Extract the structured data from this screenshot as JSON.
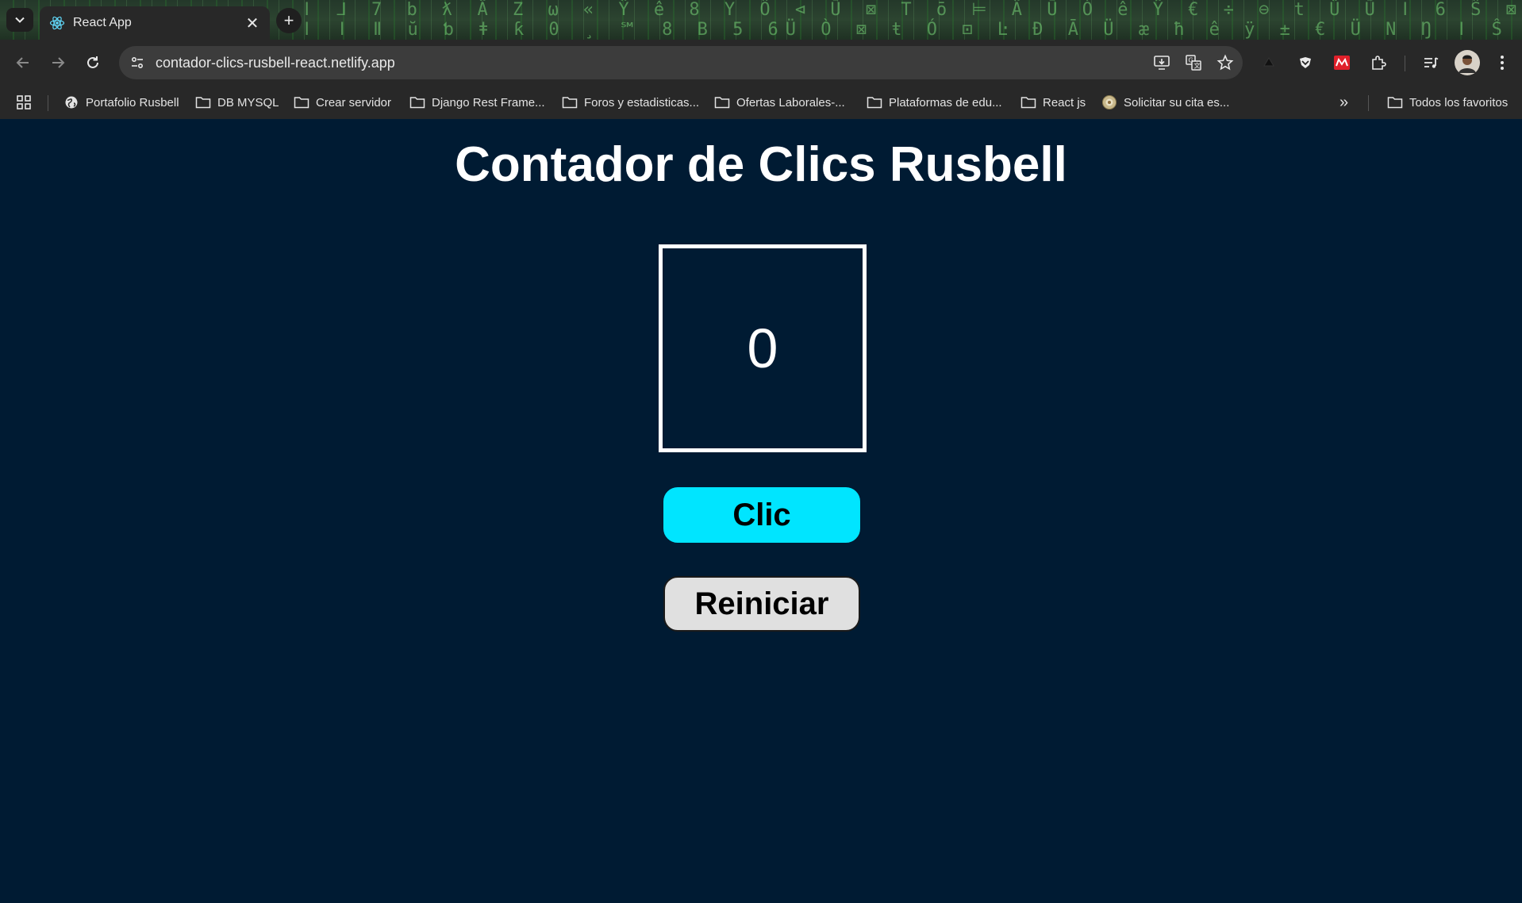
{
  "browser": {
    "tab": {
      "title": "React App"
    },
    "address_bar": {
      "url": "contador-clics-rusbell-react.netlify.app"
    },
    "bookmarks": [
      {
        "label": "Portafolio Rusbell",
        "icon": "globe-icon"
      },
      {
        "label": "DB MYSQL",
        "icon": "folder-icon"
      },
      {
        "label": "Crear servidor",
        "icon": "folder-icon"
      },
      {
        "label": "Django Rest Frame...",
        "icon": "folder-icon"
      },
      {
        "label": "Foros y estadisticas...",
        "icon": "folder-icon"
      },
      {
        "label": "Ofertas Laborales-...",
        "icon": "folder-icon"
      },
      {
        "label": "Plataformas de edu...",
        "icon": "folder-icon"
      },
      {
        "label": "React js",
        "icon": "folder-icon"
      },
      {
        "label": "Solicitar su cita es...",
        "icon": "seal-icon"
      }
    ],
    "all_bookmarks_label": "Todos los favoritos",
    "overflow_label": "»"
  },
  "app": {
    "title": "Contador de Clics Rusbell",
    "count": "0",
    "click_button_label": "Clic",
    "reset_button_label": "Reiniciar"
  },
  "colors": {
    "page_background": "#001b33",
    "click_button": "#00e5ff",
    "reset_button": "#e0e0e0",
    "counter_border": "#ffffff"
  }
}
